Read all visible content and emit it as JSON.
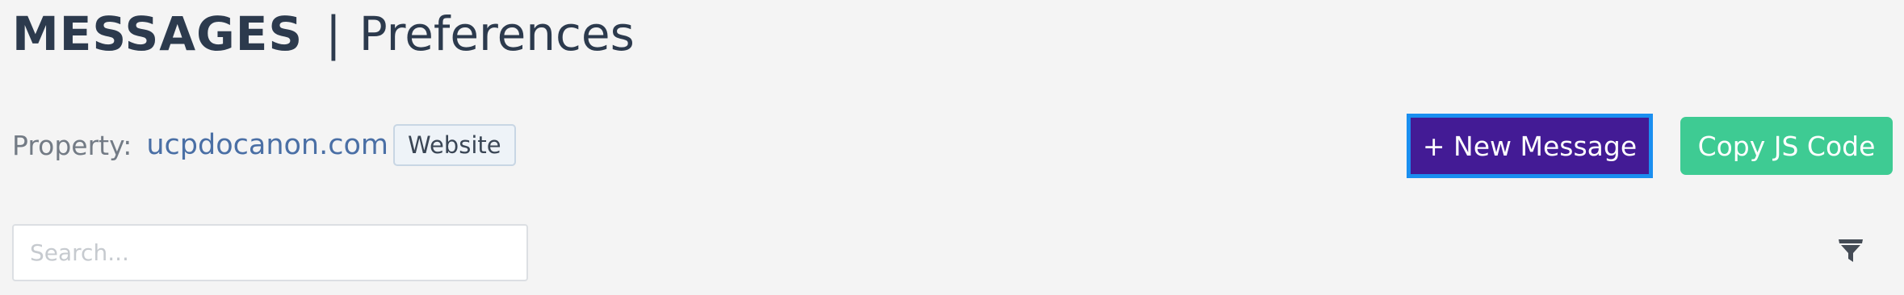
{
  "header": {
    "title": "MESSAGES",
    "separator": "|",
    "subtitle": "Preferences"
  },
  "property": {
    "label": "Property:",
    "value": "ucpdocanon.com",
    "badge": "Website"
  },
  "actions": {
    "new_message_label": "+ New Message",
    "copy_js_label": "Copy JS Code"
  },
  "search": {
    "placeholder": "Search...",
    "value": ""
  },
  "icons": {
    "filter": "filter-icon"
  },
  "colors": {
    "title": "#2c3a4d",
    "property_value": "#4a6fa5",
    "new_message_bg": "#431b95",
    "new_message_focus_border": "#1a8ff0",
    "copy_js_bg": "#3ecb93"
  }
}
